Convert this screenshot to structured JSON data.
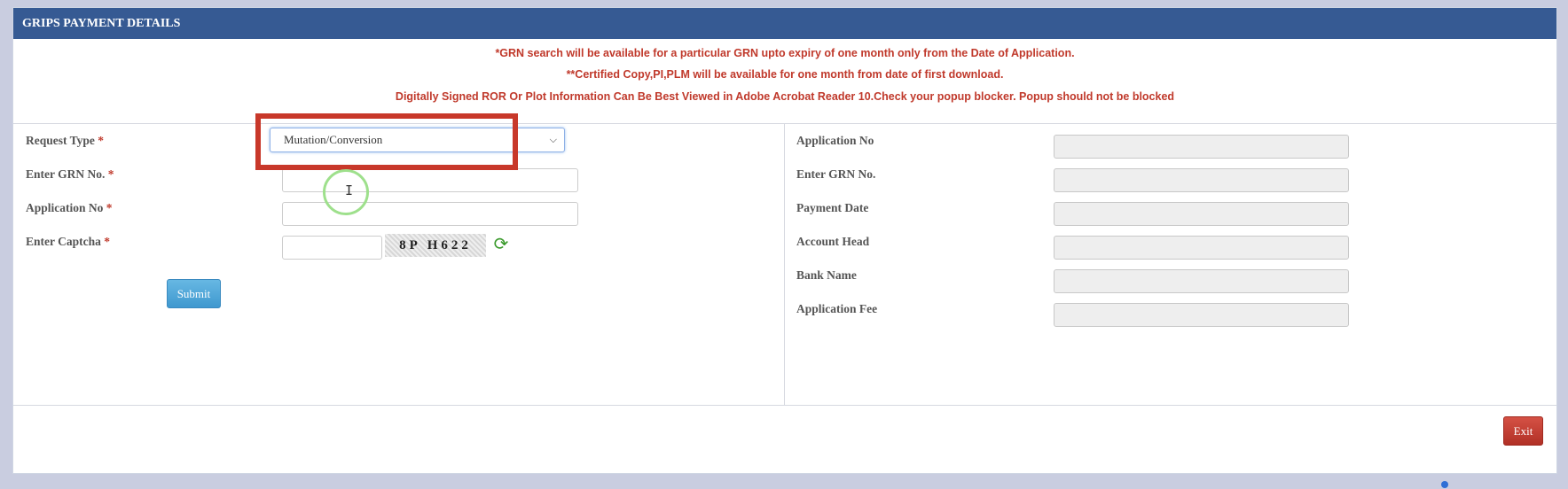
{
  "header": {
    "title": "GRIPS PAYMENT DETAILS"
  },
  "notices": [
    "*GRN search will be available for a particular GRN upto expiry of one month only from the Date of Application.",
    "**Certified Copy,PI,PLM will be available for one month from date of first download.",
    "Digitally Signed ROR Or Plot Information Can Be Best Viewed in Adobe Acrobat Reader 10.Check your popup blocker. Popup should not be blocked"
  ],
  "form": {
    "request_type_label": "Request Type",
    "request_type_value": "Mutation/Conversion",
    "grn_label": "Enter GRN No.",
    "grn_value": "",
    "application_no_label": "Application No",
    "application_no_value": "",
    "captcha_label": "Enter Captcha",
    "captcha_value": "",
    "captcha_image_text": "8P H622",
    "required_mark": "*",
    "submit_label": "Submit"
  },
  "details": {
    "application_no_label": "Application No",
    "grn_label": "Enter GRN No.",
    "payment_date_label": "Payment Date",
    "account_head_label": "Account Head",
    "bank_name_label": "Bank Name",
    "application_fee_label": "Application Fee"
  },
  "footer": {
    "exit_label": "Exit"
  },
  "colors": {
    "header_bg": "#365a93",
    "notice_text": "#c0392b",
    "submit_bg": "#4fa6d8",
    "exit_bg": "#c0392b",
    "highlight_box": "#c8382a"
  },
  "icons": {
    "captcha_refresh": "refresh-icon",
    "cursor": "text-cursor-icon"
  }
}
